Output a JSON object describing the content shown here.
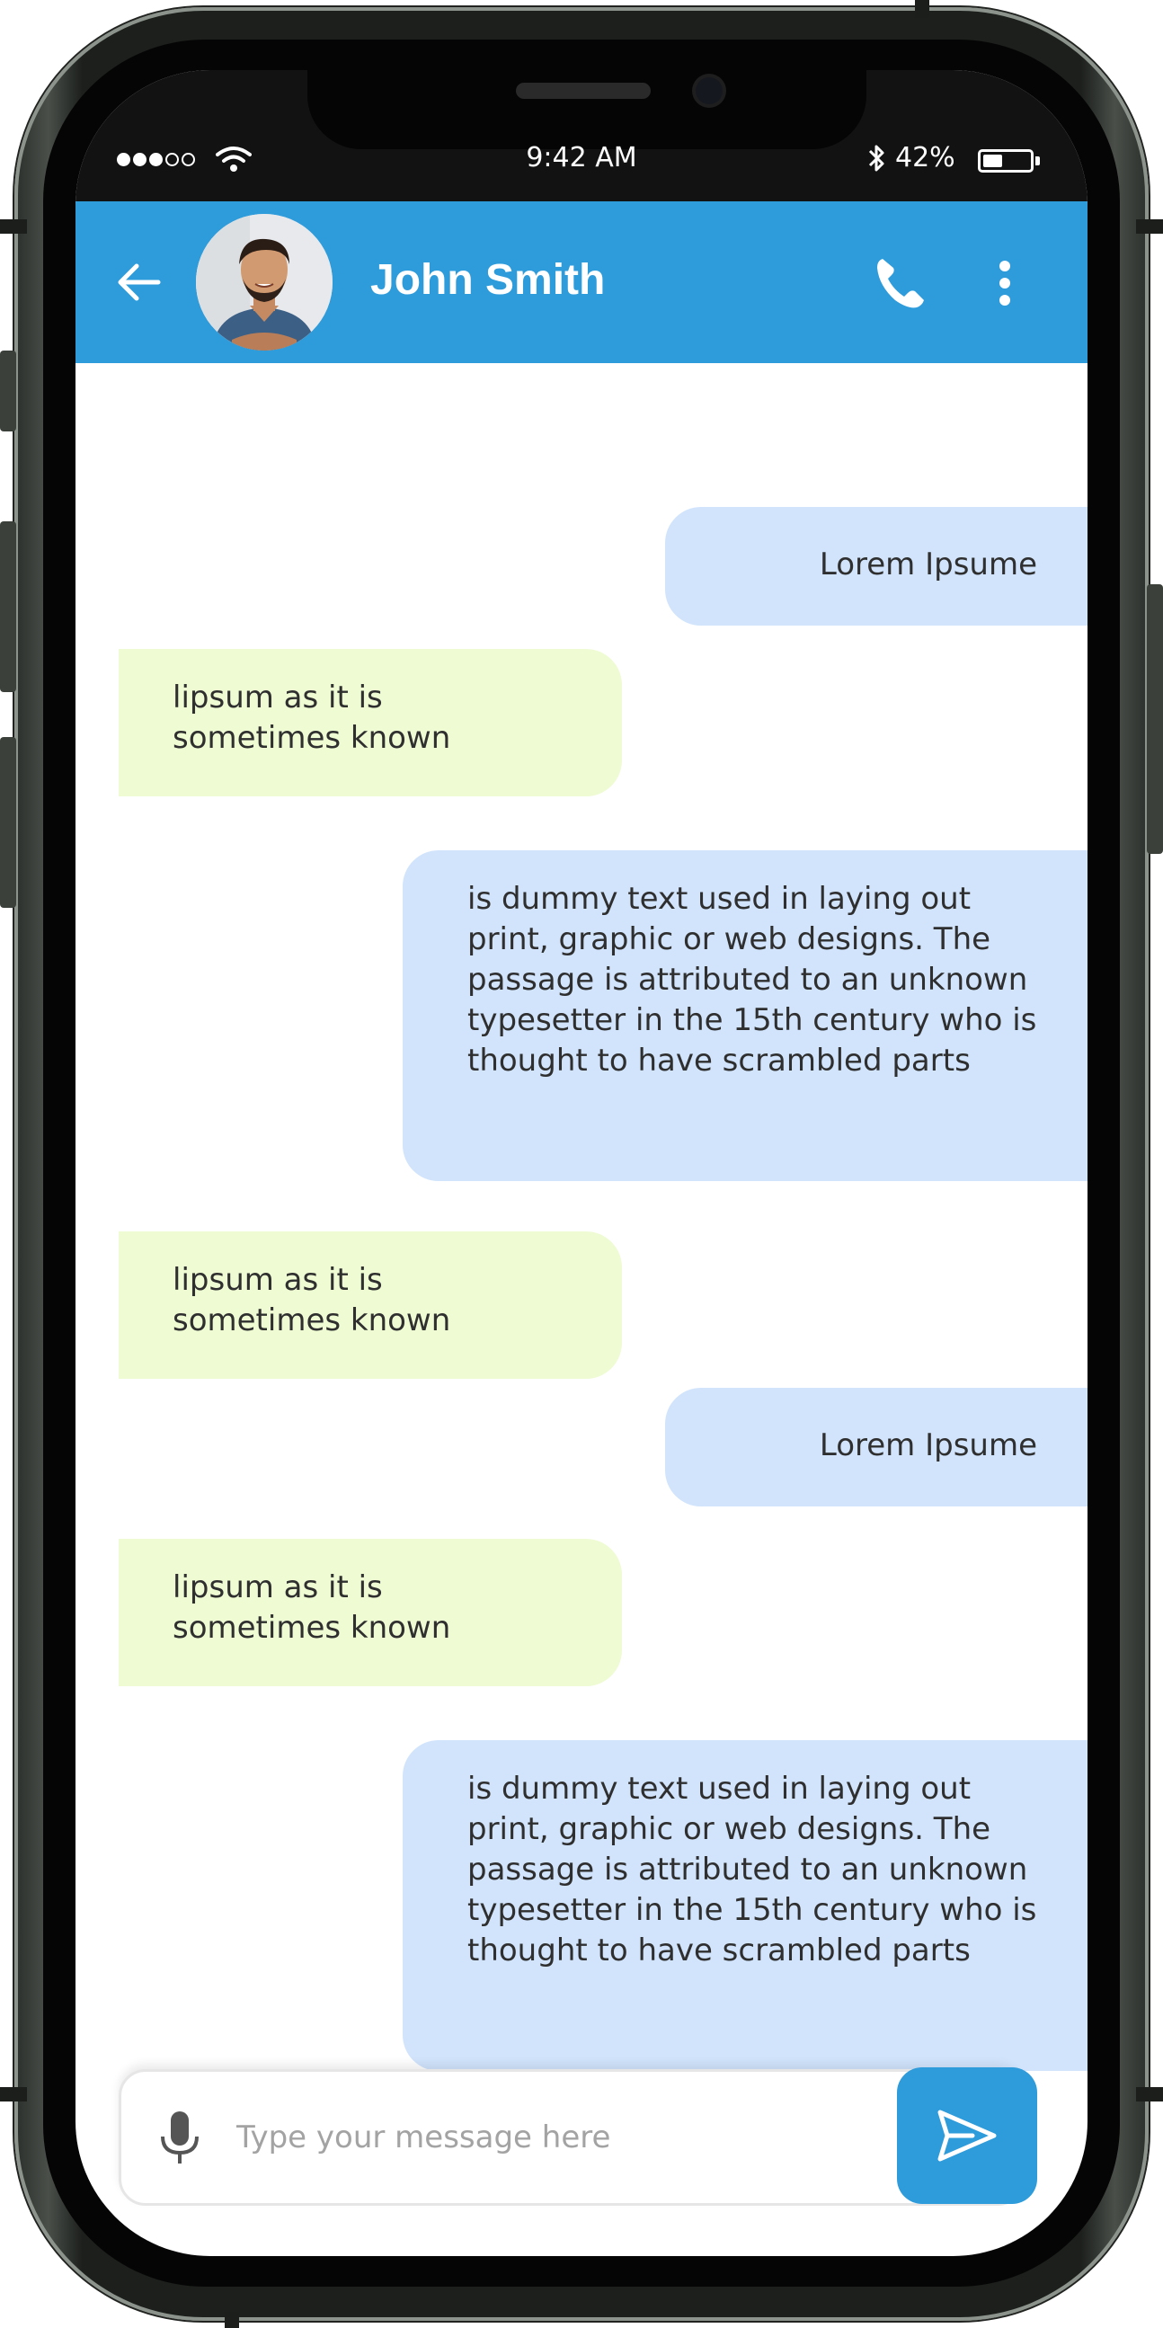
{
  "status_bar": {
    "time": "9:42 AM",
    "battery_percent": "42%",
    "battery_level": 0.42,
    "signal_bars_filled": 3,
    "signal_bars_total": 5,
    "icons": [
      "wifi-icon",
      "bluetooth-icon",
      "battery-icon"
    ]
  },
  "header": {
    "contact_name": "John Smith",
    "color": "#2e9bdb",
    "icons": [
      "back-arrow-icon",
      "avatar",
      "phone-icon",
      "more-vertical-icon"
    ]
  },
  "messages": [
    {
      "direction": "sent",
      "text": "Lorem Ipsume"
    },
    {
      "direction": "received",
      "text": "lipsum as it is\nsometimes known"
    },
    {
      "direction": "sent",
      "text": "is dummy text used in laying out print, graphic or web designs. The passage is attributed to an unknown typesetter in the 15th century who is thought to have scrambled parts"
    },
    {
      "direction": "received",
      "text": "lipsum as it is\nsometimes known"
    },
    {
      "direction": "sent",
      "text": "Lorem Ipsume"
    },
    {
      "direction": "received",
      "text": "lipsum as it is\nsometimes known"
    },
    {
      "direction": "sent",
      "text": "is dummy text used in laying out print, graphic or web designs. The passage is attributed to an unknown typesetter in the 15th century who is thought to have scrambled parts"
    }
  ],
  "composer": {
    "placeholder": "Type your message here",
    "value": "",
    "icons": [
      "mic-icon",
      "send-icon"
    ]
  },
  "colors": {
    "accent": "#2e9bdb",
    "sent_bubble": "#d1e4fc",
    "received_bubble": "#eefbd3",
    "status_bar": "#121212"
  }
}
